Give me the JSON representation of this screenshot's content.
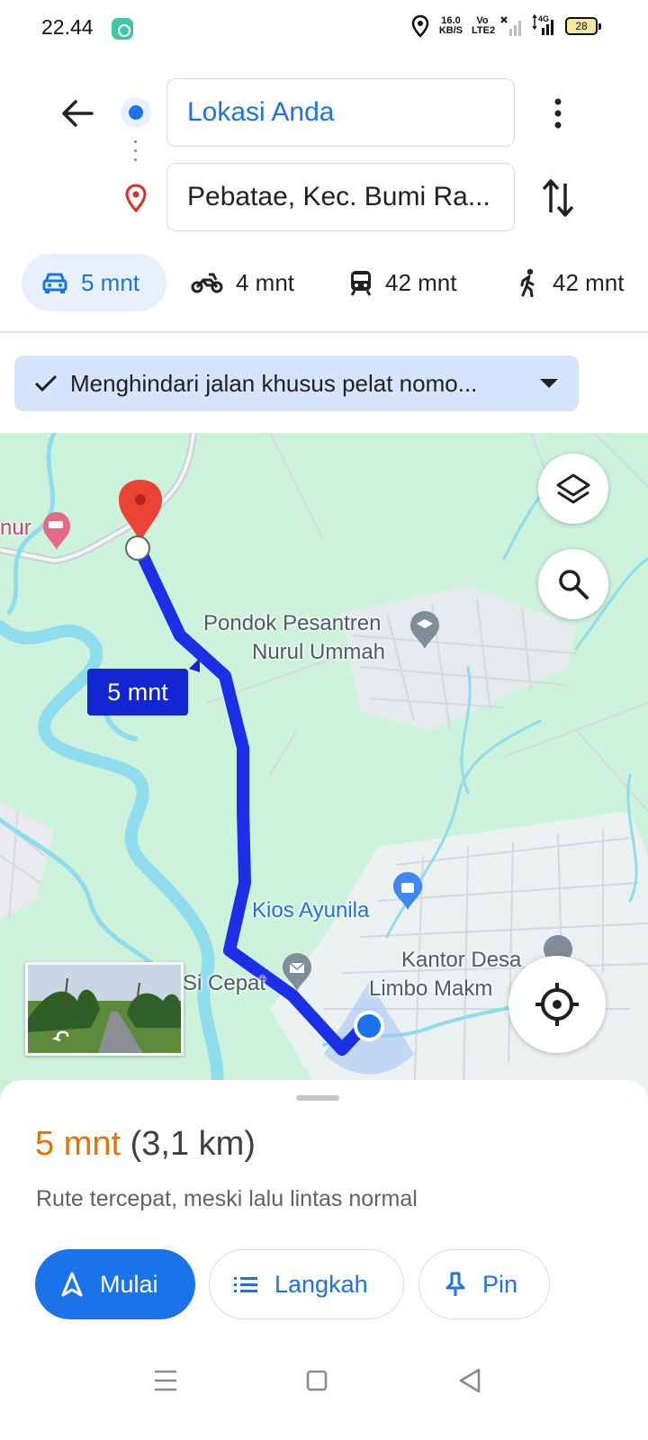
{
  "status_bar": {
    "time": "22.44",
    "speed_value": "16.0",
    "speed_unit": "KB/S",
    "volte_top": "Vo",
    "volte_bottom": "LTE2",
    "network": "4G",
    "battery": "28"
  },
  "directions": {
    "origin": "Lokasi Anda",
    "destination": "Pebatae, Kec. Bumi Ra..."
  },
  "travel_modes": [
    {
      "mode": "car",
      "time": "5 mnt",
      "selected": true
    },
    {
      "mode": "motorcycle",
      "time": "4 mnt"
    },
    {
      "mode": "transit",
      "time": "42 mnt"
    },
    {
      "mode": "walk",
      "time": "42 mnt"
    }
  ],
  "route_option": {
    "label": "Menghindari jalan khusus pelat nomo..."
  },
  "map": {
    "route_time_label": "5 mnt",
    "pois": {
      "hotel_partial": "nur",
      "pesantren_line1": "Pondok Pesantren",
      "pesantren_line2": "Nurul Ummah",
      "kios": "Kios Ayunila",
      "sicepat": "Si Cepat",
      "kantor_line1": "Kantor Desa",
      "kantor_line2": "Limbo Makm"
    }
  },
  "summary": {
    "duration": "5 mnt",
    "distance": "(3,1 km)",
    "description": "Rute tercepat, meski lalu lintas normal"
  },
  "actions": {
    "start": "Mulai",
    "steps": "Langkah",
    "pin": "Pin"
  },
  "colors": {
    "accent": "#1a73e8",
    "route": "#1a2fe6",
    "duration": "#e37400",
    "map_land": "#cdf2dc",
    "water": "#8fdcec"
  }
}
